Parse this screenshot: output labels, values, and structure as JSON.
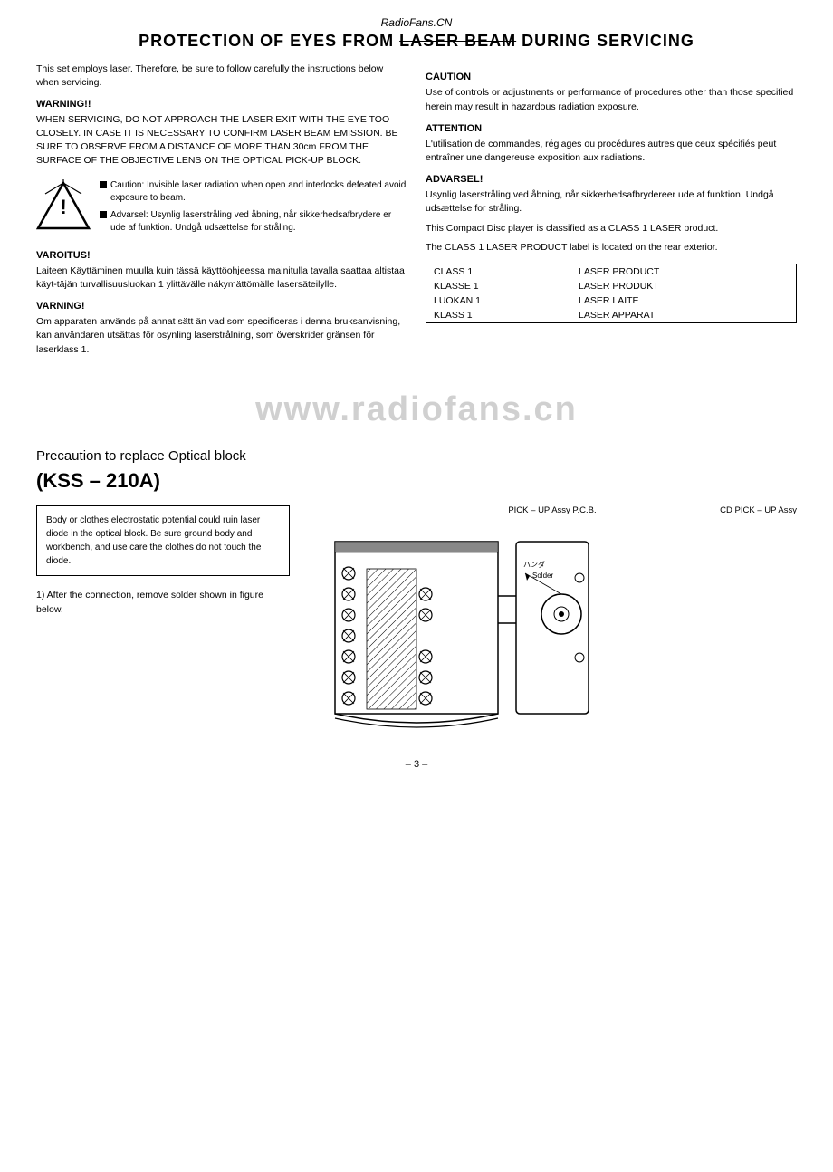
{
  "header": {
    "site": "RadioFans.CN",
    "title_part1": "PROTECTION OF EYES FROM ",
    "title_strikethrough": "LASER BEAM",
    "title_part2": " DURING SERVICING"
  },
  "intro": {
    "text": "This set employs laser. Therefore, be sure to follow carefully the instructions below when servicing."
  },
  "left_column": {
    "warning1": {
      "title": "WARNING!!",
      "body": "WHEN SERVICING, DO NOT APPROACH THE LASER EXIT WITH THE EYE TOO CLOSELY. IN CASE IT IS NECESSARY TO CONFIRM LASER BEAM EMISSION.  BE SURE TO OBSERVE FROM A DISTANCE OF MORE THAN 30cm FROM THE SURFACE OF THE OBJECTIVE LENS ON THE OPTICAL PICK-UP BLOCK."
    },
    "caution_items": [
      "Caution: Invisible laser radiation when open and interlocks defeated avoid exposure to beam.",
      "Advarsel: Usynlig laserstråling ved åbning, når sikkerhedsafbrydere er ude af funktion. Undgå udsættelse for stråling."
    ],
    "varoitus": {
      "title": "VAROITUS!",
      "body": "Laiteen Käyttäminen muulla kuin tässä käyttöohjeessa mainitulla tavalla saattaa altistaa käyt-täjän turvallisuusluokan 1 ylittävälle näkymättömälle lasersäteilylle."
    },
    "varning": {
      "title": "VARNING!",
      "body": "Om apparaten används på annat sätt än vad som specificeras i denna bruksanvisning, kan användaren utsättas för osynling laserstrålning, som överskrider gränsen för laserklass 1."
    }
  },
  "right_column": {
    "caution": {
      "title": "CAUTION",
      "body": "Use of controls or adjustments or performance of procedures other than those specified herein may result in hazardous radiation exposure."
    },
    "attention": {
      "title": "ATTENTION",
      "body": "L'utilisation de commandes, réglages ou procédures autres que ceux spécifiés peut entraîner une dangereuse exposition aux radiations."
    },
    "advarsel": {
      "title": "ADVARSEL!",
      "body": "Usynlig laserstråling ved åbning, når sikkerhedsafbrydereer ude af funktion. Undgå udsættelse for stråling."
    },
    "class_text1": "This Compact Disc player is classified as a CLASS 1 LASER product.",
    "class_text2": "The CLASS 1 LASER PRODUCT label is located on the rear exterior.",
    "laser_table": {
      "rows": [
        [
          "CLASS 1",
          "LASER PRODUCT"
        ],
        [
          "KLASSE 1",
          "LASER PRODUKT"
        ],
        [
          "LUOKAN 1",
          "LASER LAITE"
        ],
        [
          "KLASS 1",
          "LASER APPARAT"
        ]
      ]
    }
  },
  "watermark": {
    "text": "www.radiofans.cn"
  },
  "precaution": {
    "heading": "Precaution to replace Optical block",
    "model": "(KSS – 210A)",
    "warning_note": "Body or clothes electrostatic potential could ruin laser diode in the optical block. Be sure ground body and workbench, and use care the clothes do not touch the diode.",
    "step1": "1)  After the connection, remove solder shown in figure below.",
    "diagram": {
      "label_top": "PICK – UP Assy  P.C.B.",
      "label_cd": "CD PICK – UP Assy",
      "label_solder": "Solder",
      "label_handy": "ハンダ"
    }
  },
  "footer": {
    "page": "– 3 –"
  }
}
